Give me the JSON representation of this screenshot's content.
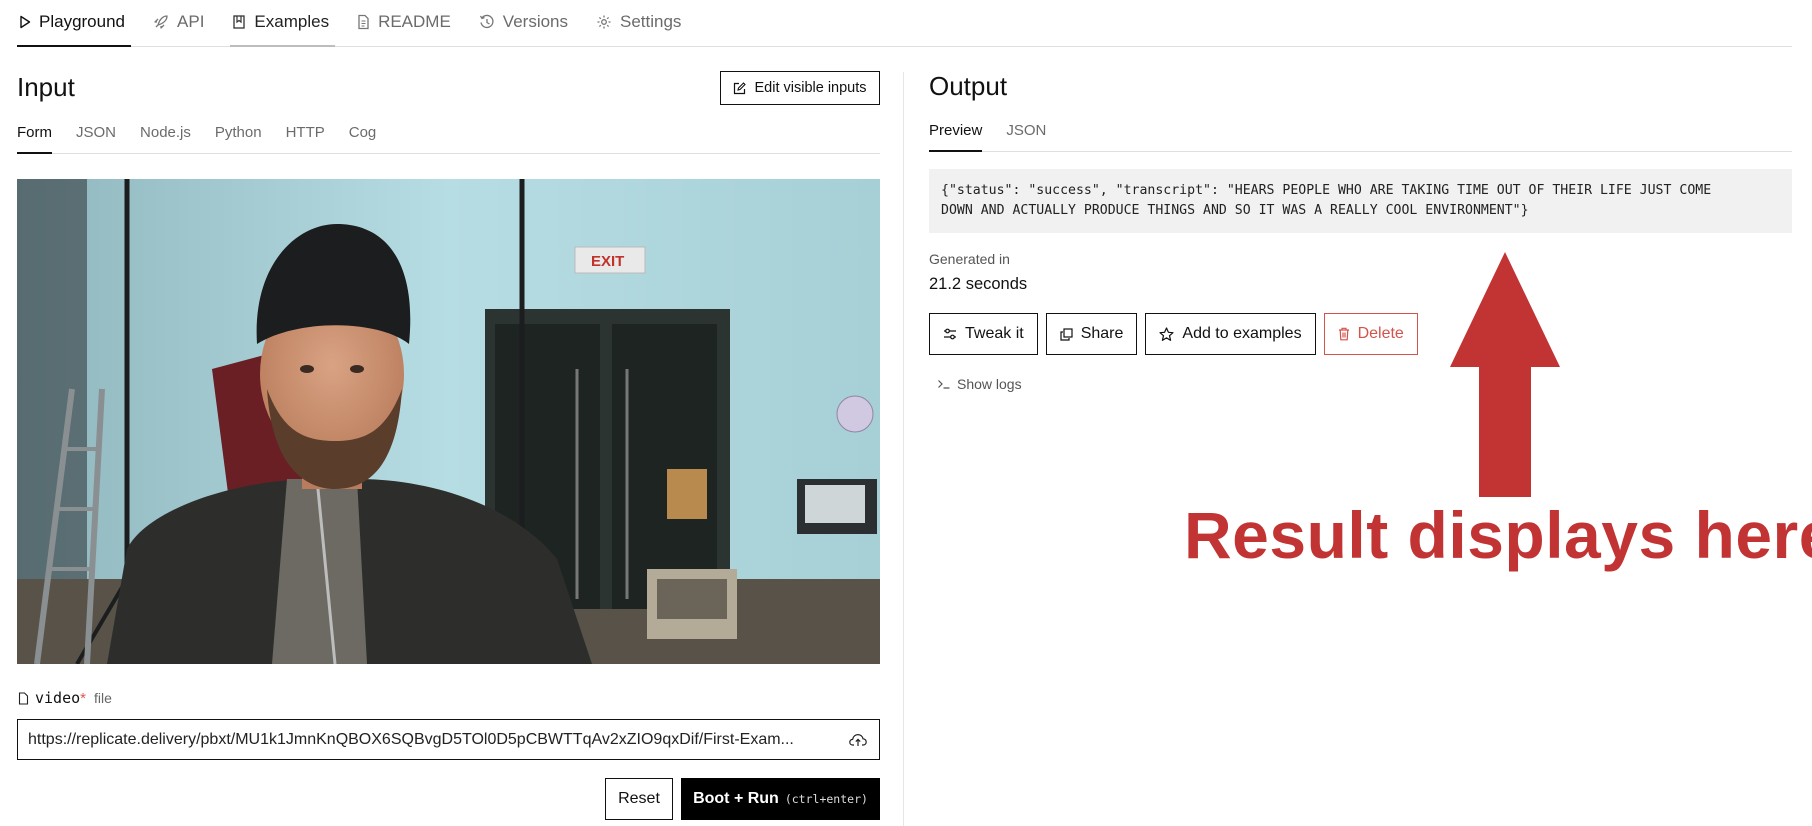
{
  "nav": {
    "tabs": [
      {
        "label": "Playground",
        "icon": "play-icon"
      },
      {
        "label": "API",
        "icon": "rocket-icon"
      },
      {
        "label": "Examples",
        "icon": "book-icon"
      },
      {
        "label": "README",
        "icon": "document-icon"
      },
      {
        "label": "Versions",
        "icon": "history-icon"
      },
      {
        "label": "Settings",
        "icon": "gear-icon"
      }
    ]
  },
  "input": {
    "title": "Input",
    "edit_button": "Edit visible inputs",
    "tabs": [
      "Form",
      "JSON",
      "Node.js",
      "Python",
      "HTTP",
      "Cog"
    ],
    "field": {
      "name": "video",
      "required_mark": "*",
      "type": "file",
      "value": "https://replicate.delivery/pbxt/MU1k1JmnKnQBOX6SQBvgD5TOl0D5pCBWTTqAv2xZIO9qxDif/First-Exam..."
    },
    "reset_label": "Reset",
    "run_label": "Boot + Run",
    "run_shortcut": "(ctrl+enter)"
  },
  "output": {
    "title": "Output",
    "tabs": [
      "Preview",
      "JSON"
    ],
    "result_line1": "{\"status\": \"success\", \"transcript\": \"HEARS PEOPLE WHO ARE TAKING TIME OUT OF THEIR LIFE JUST COME",
    "result_line2": "DOWN AND ACTUALLY PRODUCE THINGS AND SO IT WAS A REALLY COOL ENVIRONMENT\"}",
    "generated_label": "Generated in",
    "generated_value": "21.2 seconds",
    "actions": {
      "tweak": "Tweak it",
      "share": "Share",
      "add": "Add to examples",
      "delete": "Delete"
    },
    "show_logs": "Show logs"
  },
  "annotation": {
    "text": "Result displays here",
    "color": "#c23434"
  },
  "colors": {
    "accent": "#111111",
    "danger": "#d4534a",
    "annotation": "#c23434"
  }
}
